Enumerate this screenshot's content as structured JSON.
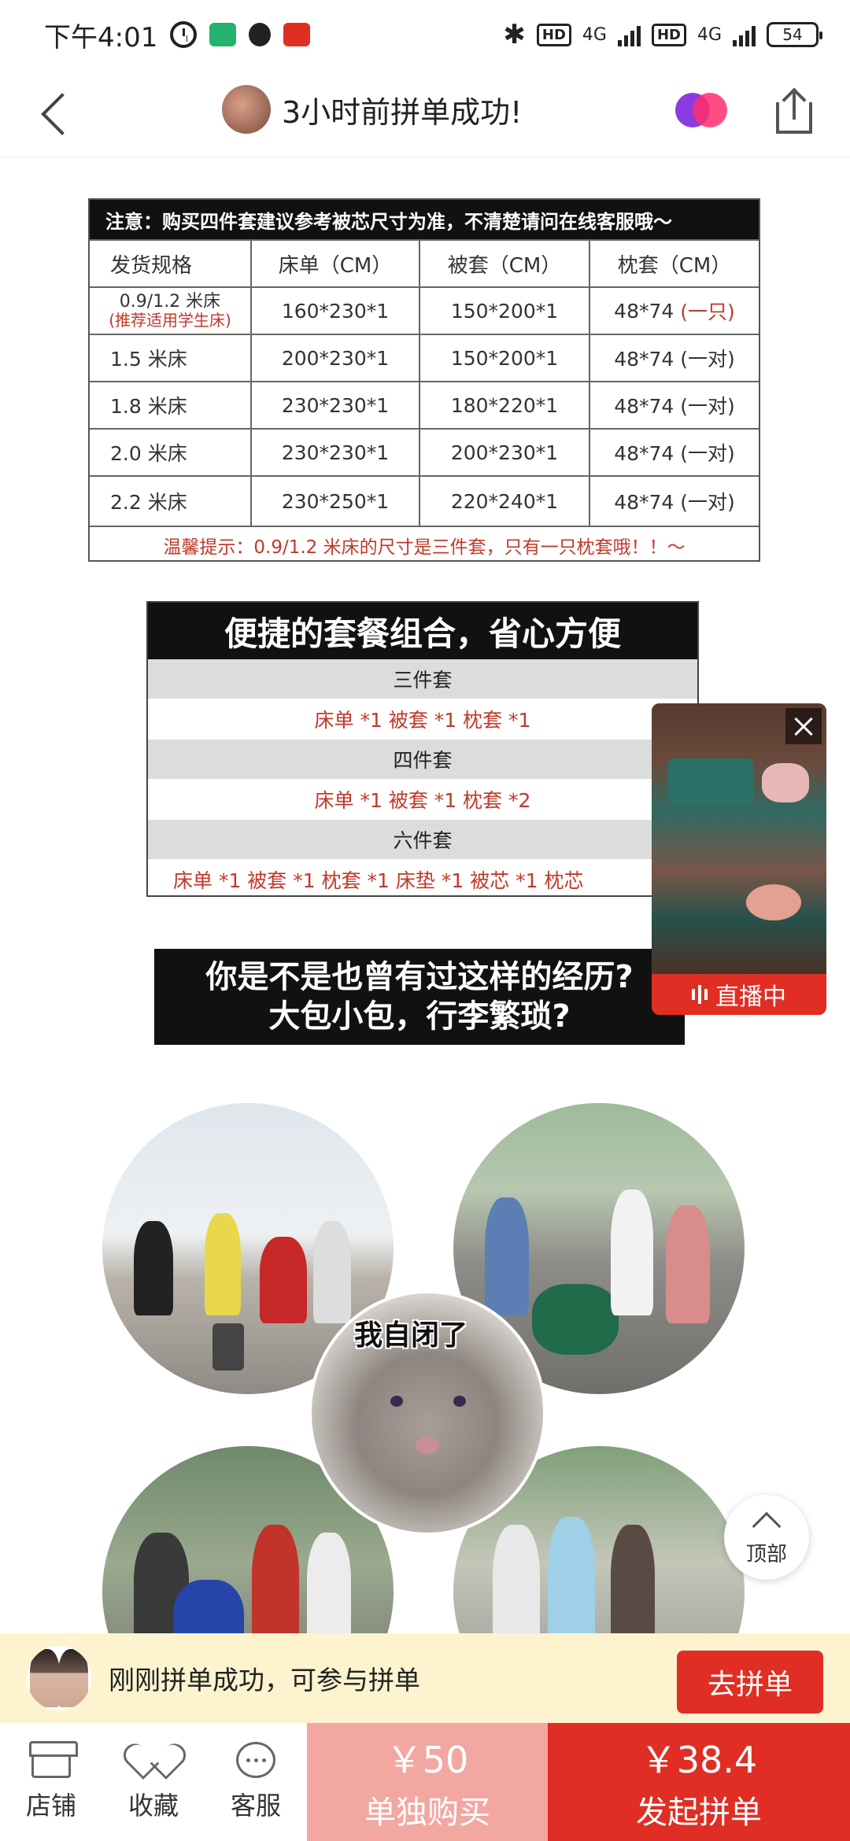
{
  "status_bar": {
    "time": "下午4:01",
    "net_1": "HD",
    "net_1_type": "4G",
    "net_2": "HD",
    "net_2_type": "4G",
    "battery": "54"
  },
  "header": {
    "title": "3小时前拼单成功!"
  },
  "size_table": {
    "notice": "注意：购买四件套建议参考被芯尺寸为准，不清楚请问在线客服哦～",
    "columns": [
      "发货规格",
      "床单（CM）",
      "被套（CM）",
      "枕套（CM）"
    ],
    "first_row": {
      "spec": "0.9/1.2 米床",
      "spec_note": "(推荐适用学生床)",
      "sheet": "160*230*1",
      "quilt": "150*200*1",
      "pillow": "48*74",
      "pillow_note": "(一只)"
    },
    "rows": [
      {
        "spec": "1.5 米床",
        "sheet": "200*230*1",
        "quilt": "150*200*1",
        "pillow": "48*74 (一对)"
      },
      {
        "spec": "1.8 米床",
        "sheet": "230*230*1",
        "quilt": "180*220*1",
        "pillow": "48*74 (一对)"
      },
      {
        "spec": "2.0 米床",
        "sheet": "230*230*1",
        "quilt": "200*230*1",
        "pillow": "48*74 (一对)"
      },
      {
        "spec": "2.2 米床",
        "sheet": "230*250*1",
        "quilt": "220*240*1",
        "pillow": "48*74 (一对)"
      }
    ],
    "footer": "温馨提示：0.9/1.2 米床的尺寸是三件套，只有一只枕套哦！！～"
  },
  "combo": {
    "title": "便捷的套餐组合，省心方便",
    "sets": [
      {
        "name": "三件套",
        "items": "床单 *1   被套 *1   枕套 *1"
      },
      {
        "name": "四件套",
        "items": "床单 *1   被套 *1   枕套 *2"
      },
      {
        "name": "六件套",
        "items": "床单 *1   被套 *1   枕套 *1   床垫 *1   被芯 *1   枕芯"
      }
    ]
  },
  "caption": {
    "line1": "你是不是也曾有过这样的经历?",
    "line2": "大包小包，行李繁琐?"
  },
  "meme_text": "我自闭了",
  "live": {
    "badge": "直播中"
  },
  "top_button": "顶部",
  "group_banner": {
    "text": "刚刚拼单成功，可参与拼单",
    "button": "去拼单"
  },
  "bottom_bar": {
    "store": "店铺",
    "favorite": "收藏",
    "service": "客服",
    "alone_price": "￥50",
    "alone_label": "单独购买",
    "group_price": "￥38.4",
    "group_label": "发起拼单"
  },
  "colors": {
    "accent": "#e02e24",
    "accent_light": "#f3a7a1",
    "banner_bg": "#fdf3cf"
  }
}
